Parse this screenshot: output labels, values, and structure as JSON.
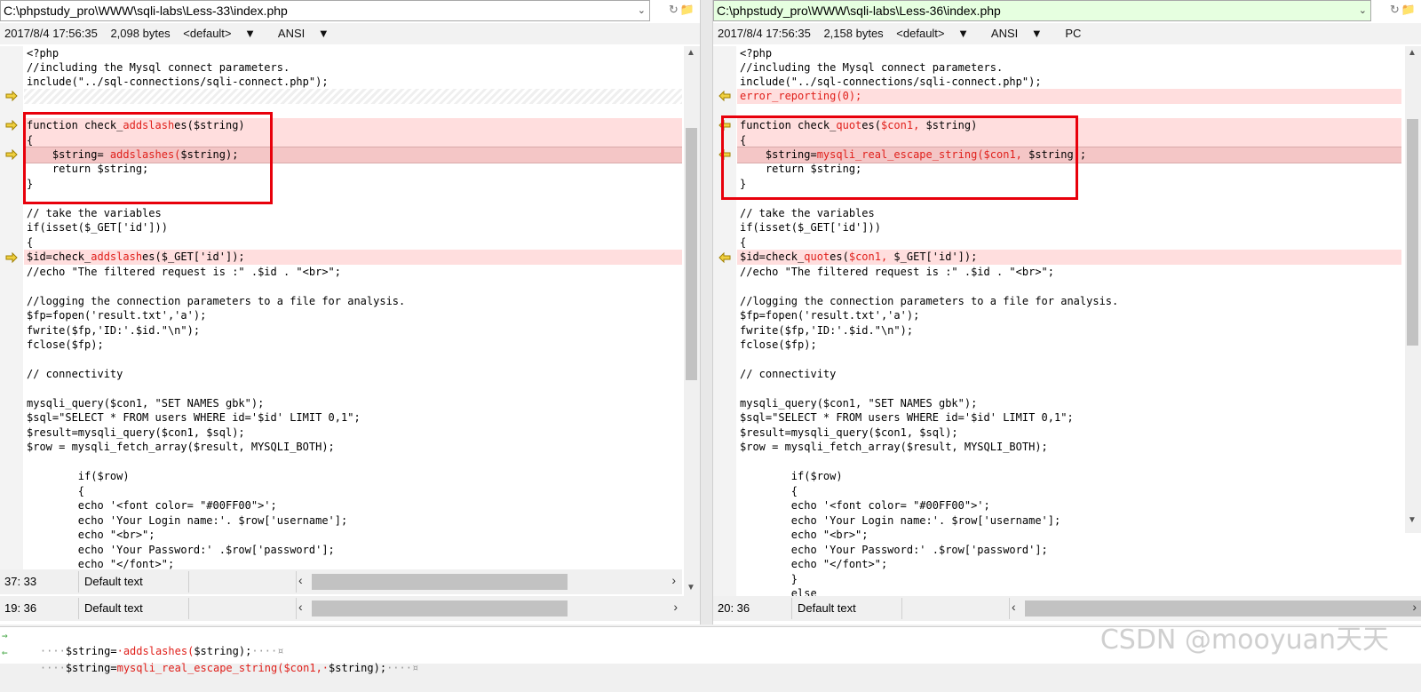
{
  "left": {
    "path": "C:\\phpstudy_pro\\WWW\\sqli-labs\\Less-33\\index.php",
    "datetime": "2017/8/4 17:56:35",
    "size": "2,098 bytes",
    "encoding_default": "<default>",
    "charset": "ANSI",
    "line_ending": "",
    "status1": {
      "pos": "37: 33",
      "mode": "Default text"
    },
    "status2": {
      "pos": "19: 36",
      "mode": "Default text"
    },
    "lines": {
      "l0": "<?php",
      "l1": "//including the Mysql connect parameters.",
      "l2": "include(\"../sql-connections/sqli-connect.php\");",
      "l4": {
        "a": "function check_",
        "b": "addslash",
        "c": "es($string)"
      },
      "l5": "{",
      "l6": {
        "a": "    $string= ",
        "b": "addslashes(",
        "c": "$string);"
      },
      "l7": "    return $string;",
      "l8": "}",
      "l10": "// take the variables",
      "l11": "if(isset($_GET['id']))",
      "l12": "{",
      "l13": {
        "a": "$id=check_",
        "b": "addslash",
        "c": "es($_GET['id']);"
      },
      "l14": "//echo \"The filtered request is :\" .$id . \"<br>\";",
      "l16": "//logging the connection parameters to a file for analysis.",
      "l17": "$fp=fopen('result.txt','a');",
      "l18": "fwrite($fp,'ID:'.$id.\"\\n\");",
      "l19": "fclose($fp);",
      "l21": "// connectivity",
      "l23": "mysqli_query($con1, \"SET NAMES gbk\");",
      "l24": "$sql=\"SELECT * FROM users WHERE id='$id' LIMIT 0,1\";",
      "l25": "$result=mysqli_query($con1, $sql);",
      "l26": "$row = mysqli_fetch_array($result, MYSQLI_BOTH);",
      "l28": "        if($row)",
      "l29": "        {",
      "l30": "        echo '<font color= \"#00FF00\">';",
      "l31": "        echo 'Your Login name:'. $row['username'];",
      "l32": "        echo \"<br>\";",
      "l33": "        echo 'Your Password:' .$row['password'];",
      "l34": "        echo \"</font>\";"
    }
  },
  "right": {
    "path": "C:\\phpstudy_pro\\WWW\\sqli-labs\\Less-36\\index.php",
    "datetime": "2017/8/4 17:56:35",
    "size": "2,158 bytes",
    "encoding_default": "<default>",
    "charset": "ANSI",
    "line_ending": "PC",
    "status1": {
      "pos": "20: 36",
      "mode": "Default text"
    },
    "lines": {
      "l0": "<?php",
      "l1": "//including the Mysql connect parameters.",
      "l2": "include(\"../sql-connections/sqli-connect.php\");",
      "l3": "error_reporting(0);",
      "l4": {
        "a": "function check_",
        "b": "quot",
        "c": "es(",
        "d": "$con1, ",
        "e": "$string)"
      },
      "l5": "{",
      "l6": {
        "a": "    $string=",
        "b": "mysqli_real_escape_string(",
        "c": "$con1, ",
        "d": "$string);"
      },
      "l7": "    return $string;",
      "l8": "}",
      "l10": "// take the variables",
      "l11": "if(isset($_GET['id']))",
      "l12": "{",
      "l13": {
        "a": "$id=check_",
        "b": "quot",
        "c": "es(",
        "d": "$con1, ",
        "e": "$_GET['id']);"
      },
      "l14": "//echo \"The filtered request is :\" .$id . \"<br>\";",
      "l16": "//logging the connection parameters to a file for analysis.",
      "l17": "$fp=fopen('result.txt','a');",
      "l18": "fwrite($fp,'ID:'.$id.\"\\n\");",
      "l19": "fclose($fp);",
      "l21": "// connectivity",
      "l23": "mysqli_query($con1, \"SET NAMES gbk\");",
      "l24": "$sql=\"SELECT * FROM users WHERE id='$id' LIMIT 0,1\";",
      "l25": "$result=mysqli_query($con1, $sql);",
      "l26": "$row = mysqli_fetch_array($result, MYSQLI_BOTH);",
      "l28": "        if($row)",
      "l29": "        {",
      "l30": "        echo '<font color= \"#00FF00\">';",
      "l31": "        echo 'Your Login name:'. $row['username'];",
      "l32": "        echo \"<br>\";",
      "l33": "        echo 'Your Password:' .$row['password'];",
      "l34": "        echo \"</font>\";",
      "l35": "        }",
      "l36": "        else"
    }
  },
  "bottom": {
    "line1": {
      "dots1": "····",
      "a": "$string=",
      "b": "·addslashes(",
      "c": "$string);",
      "dots2": "····¤"
    },
    "line2": {
      "dots1": "····",
      "a": "$string=",
      "b": "mysqli_real_escape_string(",
      "c": "$con1,·",
      "d": "$string);",
      "dots2": "····¤"
    }
  },
  "watermark": "CSDN @mooyuan天天",
  "colors": {
    "diff_red": "#e0201b",
    "highlight": "#ffdede",
    "box": "#e8000b",
    "arrow": "#e8c020"
  }
}
